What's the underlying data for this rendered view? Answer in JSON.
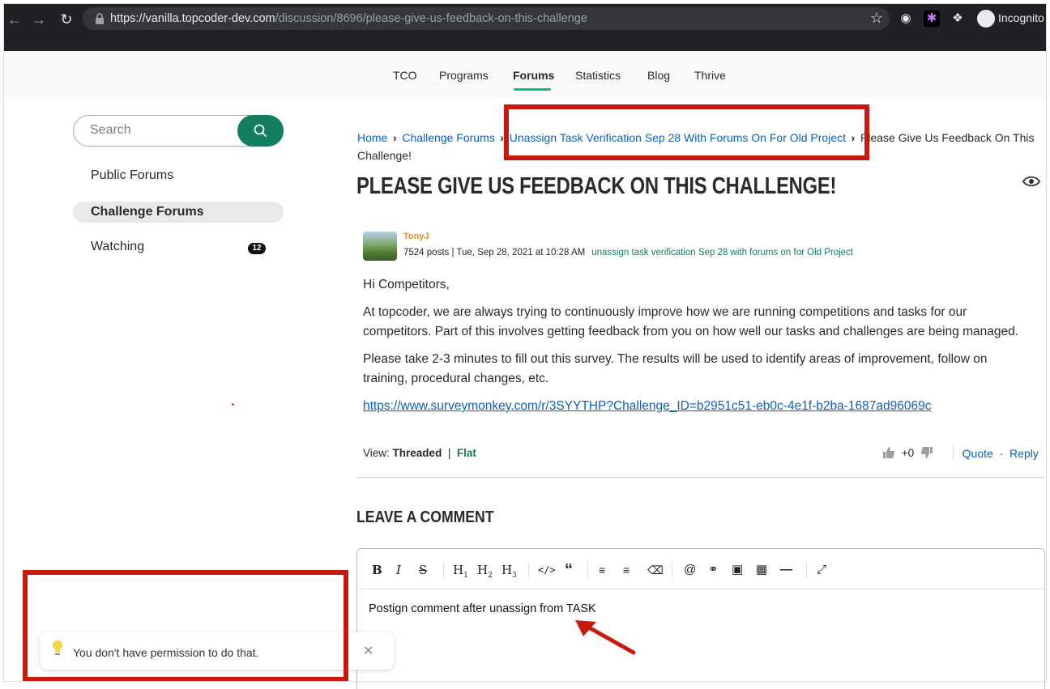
{
  "browser": {
    "url_host": "https://vanilla.topcoder-dev.com",
    "url_path": "/discussion/8696/please-give-us-feedback-on-this-challenge",
    "profile_label": "Incognito"
  },
  "site_nav": {
    "items": [
      "TCO",
      "Programs",
      "Forums",
      "Statistics",
      "Blog",
      "Thrive"
    ],
    "active": "Forums"
  },
  "sidebar": {
    "search_placeholder": "Search",
    "items": [
      {
        "label": "Public Forums"
      },
      {
        "label": "Challenge Forums",
        "active": true
      },
      {
        "label": "Watching",
        "badge": "12"
      }
    ]
  },
  "breadcrumb": {
    "home": "Home",
    "challenge_forums": "Challenge Forums",
    "project": "Unassign Task Verification Sep 28 With Forums On For Old Project",
    "current": "Please Give Us Feedback On This Challenge!"
  },
  "discussion": {
    "title": "PLEASE GIVE US FEEDBACK ON THIS CHALLENGE!",
    "author": "TonyJ",
    "meta": "7524 posts | Tue, Sep 28, 2021 at 10:28 AM",
    "category": "unassign task verification Sep 28 with forums on for Old Project",
    "paragraphs": [
      "Hi Competitors,",
      "At topcoder, we are always trying to continuously improve how we are running competitions and tasks for our competitors. Part of this involves getting feedback from you on how well our tasks and challenges are being managed.",
      "Please take 2-3 minutes to fill out this survey. The results will be used to identify areas of improvement, follow on training, procedural changes, etc."
    ],
    "survey_link": "https://www.surveymonkey.com/r/3SYYTHP?Challenge_ID=b2951c51-eb0c-4e1f-b2ba-1687ad96069c",
    "view_label": "View:",
    "view_threaded": "Threaded",
    "view_flat": "Flat",
    "score": "+0",
    "quote": "Quote",
    "reply": "Reply"
  },
  "comment": {
    "heading": "LEAVE A COMMENT",
    "toolbar": [
      "B",
      "I",
      "S",
      "H1",
      "H2",
      "H3",
      "code",
      "quote",
      "bullet-list",
      "ordered-list",
      "clear-format",
      "mention",
      "link",
      "image",
      "table",
      "hr",
      "fullscreen"
    ],
    "draft_text": "Postign comment after unassign from TASK"
  },
  "toast": {
    "message": "You don't have permission to do that."
  },
  "colors": {
    "brand_green": "#137d60",
    "link_blue": "#0d61bf",
    "author_orange": "#ef8b17",
    "annotation_red": "#c8190e"
  }
}
